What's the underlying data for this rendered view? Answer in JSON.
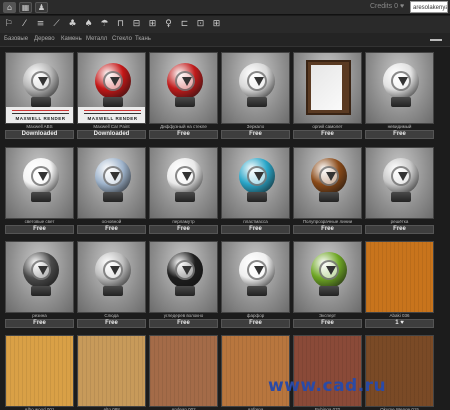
{
  "topbar": {
    "buttons": [
      {
        "icon": "home-icon",
        "glyph": "⌂"
      },
      {
        "icon": "calendar-icon",
        "glyph": "▦"
      },
      {
        "icon": "user-icon",
        "glyph": "♟"
      }
    ],
    "credits": "Credits 0 ♥",
    "user": "aresolakenyan"
  },
  "toolbar": {
    "icons": [
      {
        "name": "paint-roller-icon",
        "glyph": "⚐"
      },
      {
        "name": "brush-icon",
        "glyph": "⁄"
      },
      {
        "name": "stack-icon",
        "glyph": "≡"
      },
      {
        "name": "wand-icon",
        "glyph": "⟋"
      },
      {
        "name": "plant-icon",
        "glyph": "♣"
      },
      {
        "name": "tree-icon",
        "glyph": "♠"
      },
      {
        "name": "umbrella-icon",
        "glyph": "☂"
      },
      {
        "name": "bench-icon",
        "glyph": "⊓"
      },
      {
        "name": "car-icon",
        "glyph": "⊟"
      },
      {
        "name": "cubes-icon",
        "glyph": "⊞"
      },
      {
        "name": "lamp-icon",
        "glyph": "♀"
      },
      {
        "name": "shelf-icon",
        "glyph": "⊏"
      },
      {
        "name": "window-icon",
        "glyph": "⊡"
      },
      {
        "name": "grid-icon",
        "glyph": "⊞"
      }
    ],
    "accent": "#cfcfcf"
  },
  "categories": [
    "Базовые",
    "Дерево",
    "Камень",
    "Металл",
    "Стекло",
    "Ткань"
  ],
  "materials": [
    {
      "type": "sphere",
      "color": "#b7b7b7",
      "caption": "Maxwell ABS",
      "button": "Downloaded",
      "logo": "MAXWELL RENDER"
    },
    {
      "type": "sphere",
      "color": "#c41717",
      "caption": "Maxwell Car Paint",
      "button": "Downloaded",
      "logo": "MAXWELL RENDER"
    },
    {
      "type": "sphere",
      "color": "#c01b1b",
      "caption": "Диффузный на стекле",
      "button": "Free",
      "logo": ""
    },
    {
      "type": "sphere",
      "color": "#d8d8d8",
      "caption": "Зеркало",
      "button": "Free",
      "logo": ""
    },
    {
      "type": "door",
      "color": "#5a3a22",
      "caption": "оргий самолет",
      "button": "Free",
      "logo": ""
    },
    {
      "type": "sphere",
      "color": "#e1e1e1",
      "caption": "невидимый",
      "button": "Free",
      "logo": ""
    },
    {
      "type": "sphere",
      "color": "#f4f4f4",
      "caption": "световые свет",
      "button": "Free",
      "logo": ""
    },
    {
      "type": "sphere",
      "color": "#9fb4cc",
      "caption": "основной",
      "button": "Free",
      "logo": ""
    },
    {
      "type": "sphere",
      "color": "#eaeaea",
      "caption": "перламутр",
      "button": "Free",
      "logo": ""
    },
    {
      "type": "sphere",
      "color": "#2aa6c8",
      "caption": "пластмасса",
      "button": "Free",
      "logo": ""
    },
    {
      "type": "sphere",
      "color": "#8a4a18",
      "caption": "Полупрозрачные линии",
      "button": "Free",
      "logo": ""
    },
    {
      "type": "sphere",
      "color": "#c9c9c9",
      "caption": "решётка",
      "button": "Free",
      "logo": ""
    },
    {
      "type": "sphere",
      "color": "#4a4a4a",
      "caption": "резина",
      "button": "Free",
      "logo": ""
    },
    {
      "type": "sphere",
      "color": "#bdbdbd",
      "caption": "Слюда",
      "button": "Free",
      "logo": ""
    },
    {
      "type": "sphere",
      "color": "#1e1e1e",
      "caption": "угледерев волокно",
      "button": "Free",
      "logo": ""
    },
    {
      "type": "sphere",
      "color": "#efefef",
      "caption": "фарфор",
      "button": "Free",
      "logo": ""
    },
    {
      "type": "sphere",
      "color": "#6ea624",
      "caption": "Эксперт",
      "button": "Free",
      "logo": ""
    },
    {
      "type": "wood",
      "color": "#c8741c",
      "caption": "Abaki 036",
      "button": "1 ♥",
      "logo": ""
    },
    {
      "type": "wood",
      "color": "#d9a046",
      "caption": "Albo wood 001",
      "button": "",
      "logo": ""
    },
    {
      "type": "wood",
      "color": "#c79a5a",
      "caption": "Alto 088",
      "button": "",
      "logo": ""
    },
    {
      "type": "wood",
      "color": "#a46b48",
      "caption": "Andean 002",
      "button": "",
      "logo": ""
    },
    {
      "type": "wood",
      "color": "#b8763e",
      "caption": "Anfrena",
      "button": "",
      "logo": ""
    },
    {
      "type": "wood",
      "color": "#8a4a38",
      "caption": "Bubinga 070",
      "button": "",
      "logo": ""
    },
    {
      "type": "wood",
      "color": "#7a4a26",
      "caption": "Okume Wenge 015",
      "button": "",
      "logo": ""
    }
  ],
  "watermark": "www.cad.ru"
}
